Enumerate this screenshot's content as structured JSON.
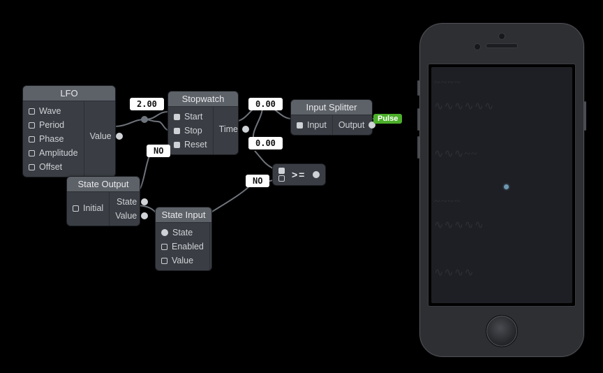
{
  "nodes": {
    "lfo": {
      "title": "LFO",
      "inputs": [
        "Wave",
        "Period",
        "Phase",
        "Amplitude",
        "Offset"
      ],
      "outputs": [
        "Value"
      ]
    },
    "stopwatch": {
      "title": "Stopwatch",
      "inputs": [
        "Start",
        "Stop",
        "Reset"
      ],
      "outputs": [
        "Time"
      ]
    },
    "input_splitter": {
      "title": "Input Splitter",
      "inputs": [
        "Input"
      ],
      "outputs": [
        "Output"
      ]
    },
    "state_output": {
      "title": "State Output",
      "inputs": [
        "Initial"
      ],
      "outputs": [
        "State",
        "Value"
      ]
    },
    "state_input": {
      "title": "State Input",
      "inputs": [
        "State",
        "Enabled",
        "Value"
      ],
      "outputs": []
    },
    "compare": {
      "operator": ">="
    }
  },
  "edge_values": {
    "lfo_out": "2.00",
    "stopwatch_time": "0.00",
    "splitter_out": "0.00",
    "state_output_state": "NO",
    "compare_out": "NO"
  },
  "tags": {
    "pulse": "Pulse"
  },
  "preview": {
    "device": "iphone"
  }
}
